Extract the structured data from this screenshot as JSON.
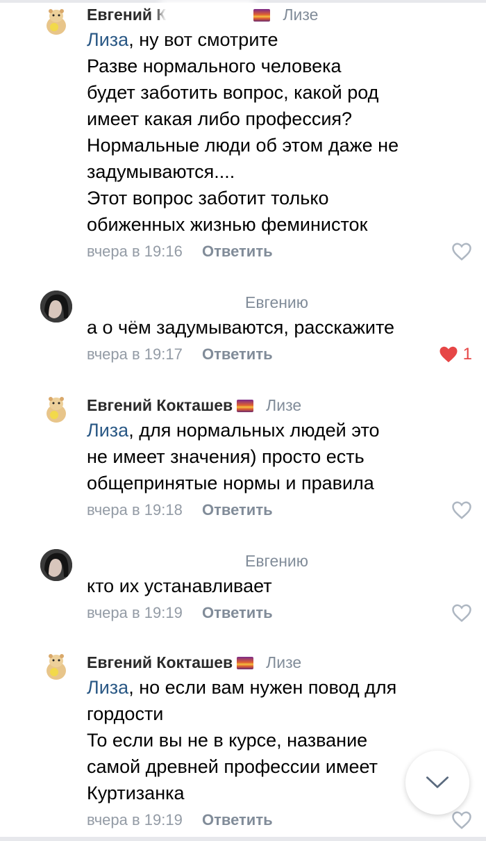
{
  "comments": [
    {
      "author": "Евгений К",
      "reply_to": "Лизе",
      "mention": "Лиза",
      "first_line": ", ну вот смотрите",
      "lines": [
        "Разве нормального человека",
        "будет заботить вопрос, какой род",
        "имеет какая либо профессия?",
        "Нормальные люди об этом даже не",
        "задумываются....",
        "Этот вопрос заботит только",
        "обиженных жизнью феминисток"
      ],
      "date": "вчера в 19:16",
      "reply_label": "Ответить"
    },
    {
      "author": "",
      "reply_to": "Евгению",
      "lines": [
        "а о чём задумываются, расскажите"
      ],
      "date": "вчера в 19:17",
      "reply_label": "Ответить",
      "like_count": "1"
    },
    {
      "author": "Евгений Кокташев",
      "reply_to": "Лизе",
      "mention": "Лиза",
      "first_line": ", для нормальных людей это",
      "lines": [
        "не имеет значения) просто есть",
        "общепринятые нормы и правила"
      ],
      "date": "вчера в 19:18",
      "reply_label": "Ответить"
    },
    {
      "author": "",
      "reply_to": "Евгению",
      "lines": [
        "кто их устанавливает"
      ],
      "date": "вчера в 19:19",
      "reply_label": "Ответить"
    },
    {
      "author": "Евгений Кокташев",
      "reply_to": "Лизе",
      "mention": "Лиза",
      "first_line": ", но если вам нужен повод для",
      "lines": [
        "гордости",
        "То если вы не в курсе, название",
        "самой древней профессии имеет ",
        "Куртизанка"
      ],
      "date": "вчера в 19:19",
      "reply_label": "Ответить"
    }
  ],
  "colors": {
    "mention": "#2a5885",
    "meta": "#939ba5",
    "like_active": "#e64646",
    "like_idle": "#aeb7c2"
  },
  "icons": {
    "like": "heart-icon",
    "scroll": "chevron-down-icon"
  }
}
